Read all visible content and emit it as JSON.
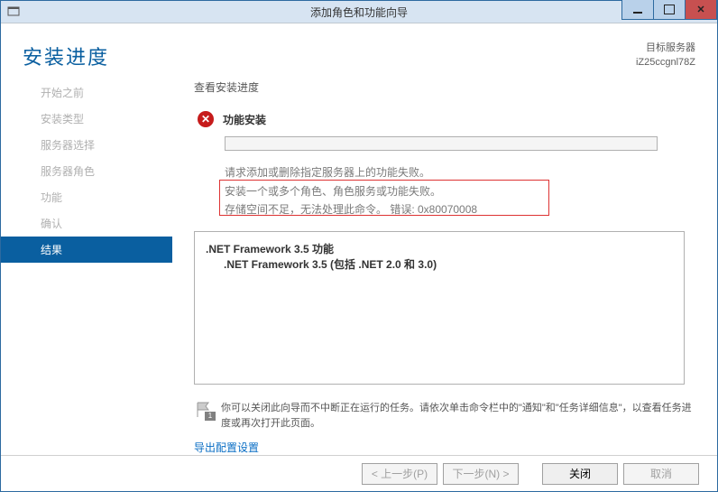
{
  "window": {
    "title": "添加角色和功能向导"
  },
  "header": {
    "title": "安装进度",
    "server_label": "目标服务器",
    "server_name": "iZ25ccgnl78Z"
  },
  "sidebar": {
    "items": [
      {
        "label": "开始之前",
        "active": false
      },
      {
        "label": "安装类型",
        "active": false
      },
      {
        "label": "服务器选择",
        "active": false
      },
      {
        "label": "服务器角色",
        "active": false
      },
      {
        "label": "功能",
        "active": false
      },
      {
        "label": "确认",
        "active": false
      },
      {
        "label": "结果",
        "active": true
      }
    ]
  },
  "main": {
    "section_label": "查看安装进度",
    "status_text": "功能安装",
    "msg1": "请求添加或删除指定服务器上的功能失败。",
    "msg2": "安装一个或多个角色、角色服务或功能失败。",
    "msg3": "存储空间不足，无法处理此命令。 错误: 0x80070008",
    "feature1": ".NET Framework 3.5 功能",
    "feature2": ".NET Framework 3.5 (包括 .NET 2.0 和 3.0)",
    "notice": "你可以关闭此向导而不中断正在运行的任务。请依次单击命令栏中的\"通知\"和\"任务详细信息\"，以查看任务进度或再次打开此页面。",
    "flag_count": "1",
    "export_link": "导出配置设置"
  },
  "footer": {
    "prev": "< 上一步(P)",
    "next": "下一步(N) >",
    "close": "关闭",
    "cancel": "取消"
  }
}
